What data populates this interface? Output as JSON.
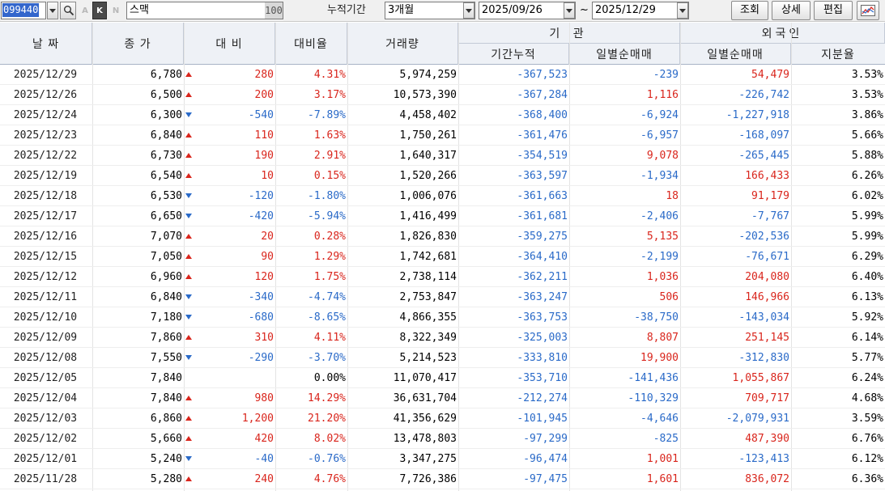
{
  "toolbar": {
    "code": "099440",
    "mini_a": "A",
    "mini_k": "K",
    "mini_n": "N",
    "name": "스맥",
    "name_num": "100",
    "period_label": "누적기간",
    "period_value": "3개월",
    "date_from": "2025/09/26",
    "tilde": "~",
    "date_to": "2025/12/29",
    "query_label": "조회",
    "detail_label": "상세",
    "edit_label": "편집"
  },
  "headers": {
    "date": "날 짜",
    "close": "종 가",
    "diff": "대 비",
    "rate": "대비율",
    "volume": "거래량",
    "inst": "기 관",
    "inst_cum": "기간누적",
    "inst_net": "일별순매매",
    "foreign": "외국인",
    "foreign_net": "일별순매매",
    "foreign_own": "지분율"
  },
  "colors": {
    "up": "#d9251c",
    "down": "#2a6ac8"
  },
  "rows": [
    {
      "date": "2025/12/29",
      "close": "6,780",
      "dir": "up",
      "diff": "280",
      "rate": "4.31%",
      "volume": "5,974,259",
      "icum": "-367,523",
      "inet": "-239",
      "fnet": "54,479",
      "fown": "3.53%"
    },
    {
      "date": "2025/12/26",
      "close": "6,500",
      "dir": "up",
      "diff": "200",
      "rate": "3.17%",
      "volume": "10,573,390",
      "icum": "-367,284",
      "inet": "1,116",
      "fnet": "-226,742",
      "fown": "3.53%"
    },
    {
      "date": "2025/12/24",
      "close": "6,300",
      "dir": "down",
      "diff": "-540",
      "rate": "-7.89%",
      "volume": "4,458,402",
      "icum": "-368,400",
      "inet": "-6,924",
      "fnet": "-1,227,918",
      "fown": "3.86%"
    },
    {
      "date": "2025/12/23",
      "close": "6,840",
      "dir": "up",
      "diff": "110",
      "rate": "1.63%",
      "volume": "1,750,261",
      "icum": "-361,476",
      "inet": "-6,957",
      "fnet": "-168,097",
      "fown": "5.66%"
    },
    {
      "date": "2025/12/22",
      "close": "6,730",
      "dir": "up",
      "diff": "190",
      "rate": "2.91%",
      "volume": "1,640,317",
      "icum": "-354,519",
      "inet": "9,078",
      "fnet": "-265,445",
      "fown": "5.88%"
    },
    {
      "date": "2025/12/19",
      "close": "6,540",
      "dir": "up",
      "diff": "10",
      "rate": "0.15%",
      "volume": "1,520,266",
      "icum": "-363,597",
      "inet": "-1,934",
      "fnet": "166,433",
      "fown": "6.26%"
    },
    {
      "date": "2025/12/18",
      "close": "6,530",
      "dir": "down",
      "diff": "-120",
      "rate": "-1.80%",
      "volume": "1,006,076",
      "icum": "-361,663",
      "inet": "18",
      "fnet": "91,179",
      "fown": "6.02%"
    },
    {
      "date": "2025/12/17",
      "close": "6,650",
      "dir": "down",
      "diff": "-420",
      "rate": "-5.94%",
      "volume": "1,416,499",
      "icum": "-361,681",
      "inet": "-2,406",
      "fnet": "-7,767",
      "fown": "5.99%"
    },
    {
      "date": "2025/12/16",
      "close": "7,070",
      "dir": "up",
      "diff": "20",
      "rate": "0.28%",
      "volume": "1,826,830",
      "icum": "-359,275",
      "inet": "5,135",
      "fnet": "-202,536",
      "fown": "5.99%"
    },
    {
      "date": "2025/12/15",
      "close": "7,050",
      "dir": "up",
      "diff": "90",
      "rate": "1.29%",
      "volume": "1,742,681",
      "icum": "-364,410",
      "inet": "-2,199",
      "fnet": "-76,671",
      "fown": "6.29%"
    },
    {
      "date": "2025/12/12",
      "close": "6,960",
      "dir": "up",
      "diff": "120",
      "rate": "1.75%",
      "volume": "2,738,114",
      "icum": "-362,211",
      "inet": "1,036",
      "fnet": "204,080",
      "fown": "6.40%"
    },
    {
      "date": "2025/12/11",
      "close": "6,840",
      "dir": "down",
      "diff": "-340",
      "rate": "-4.74%",
      "volume": "2,753,847",
      "icum": "-363,247",
      "inet": "506",
      "fnet": "146,966",
      "fown": "6.13%"
    },
    {
      "date": "2025/12/10",
      "close": "7,180",
      "dir": "down",
      "diff": "-680",
      "rate": "-8.65%",
      "volume": "4,866,355",
      "icum": "-363,753",
      "inet": "-38,750",
      "fnet": "-143,034",
      "fown": "5.92%"
    },
    {
      "date": "2025/12/09",
      "close": "7,860",
      "dir": "up",
      "diff": "310",
      "rate": "4.11%",
      "volume": "8,322,349",
      "icum": "-325,003",
      "inet": "8,807",
      "fnet": "251,145",
      "fown": "6.14%"
    },
    {
      "date": "2025/12/08",
      "close": "7,550",
      "dir": "down",
      "diff": "-290",
      "rate": "-3.70%",
      "volume": "5,214,523",
      "icum": "-333,810",
      "inet": "19,900",
      "fnet": "-312,830",
      "fown": "5.77%"
    },
    {
      "date": "2025/12/05",
      "close": "7,840",
      "dir": "flat",
      "diff": "",
      "rate": "0.00%",
      "volume": "11,070,417",
      "icum": "-353,710",
      "inet": "-141,436",
      "fnet": "1,055,867",
      "fown": "6.24%"
    },
    {
      "date": "2025/12/04",
      "close": "7,840",
      "dir": "up",
      "diff": "980",
      "rate": "14.29%",
      "volume": "36,631,704",
      "icum": "-212,274",
      "inet": "-110,329",
      "fnet": "709,717",
      "fown": "4.68%"
    },
    {
      "date": "2025/12/03",
      "close": "6,860",
      "dir": "up",
      "diff": "1,200",
      "rate": "21.20%",
      "volume": "41,356,629",
      "icum": "-101,945",
      "inet": "-4,646",
      "fnet": "-2,079,931",
      "fown": "3.59%"
    },
    {
      "date": "2025/12/02",
      "close": "5,660",
      "dir": "up",
      "diff": "420",
      "rate": "8.02%",
      "volume": "13,478,803",
      "icum": "-97,299",
      "inet": "-825",
      "fnet": "487,390",
      "fown": "6.76%"
    },
    {
      "date": "2025/12/01",
      "close": "5,240",
      "dir": "down",
      "diff": "-40",
      "rate": "-0.76%",
      "volume": "3,347,275",
      "icum": "-96,474",
      "inet": "1,001",
      "fnet": "-123,413",
      "fown": "6.12%"
    },
    {
      "date": "2025/11/28",
      "close": "5,280",
      "dir": "up",
      "diff": "240",
      "rate": "4.76%",
      "volume": "7,726,386",
      "icum": "-97,475",
      "inet": "1,601",
      "fnet": "836,072",
      "fown": "6.36%"
    }
  ]
}
